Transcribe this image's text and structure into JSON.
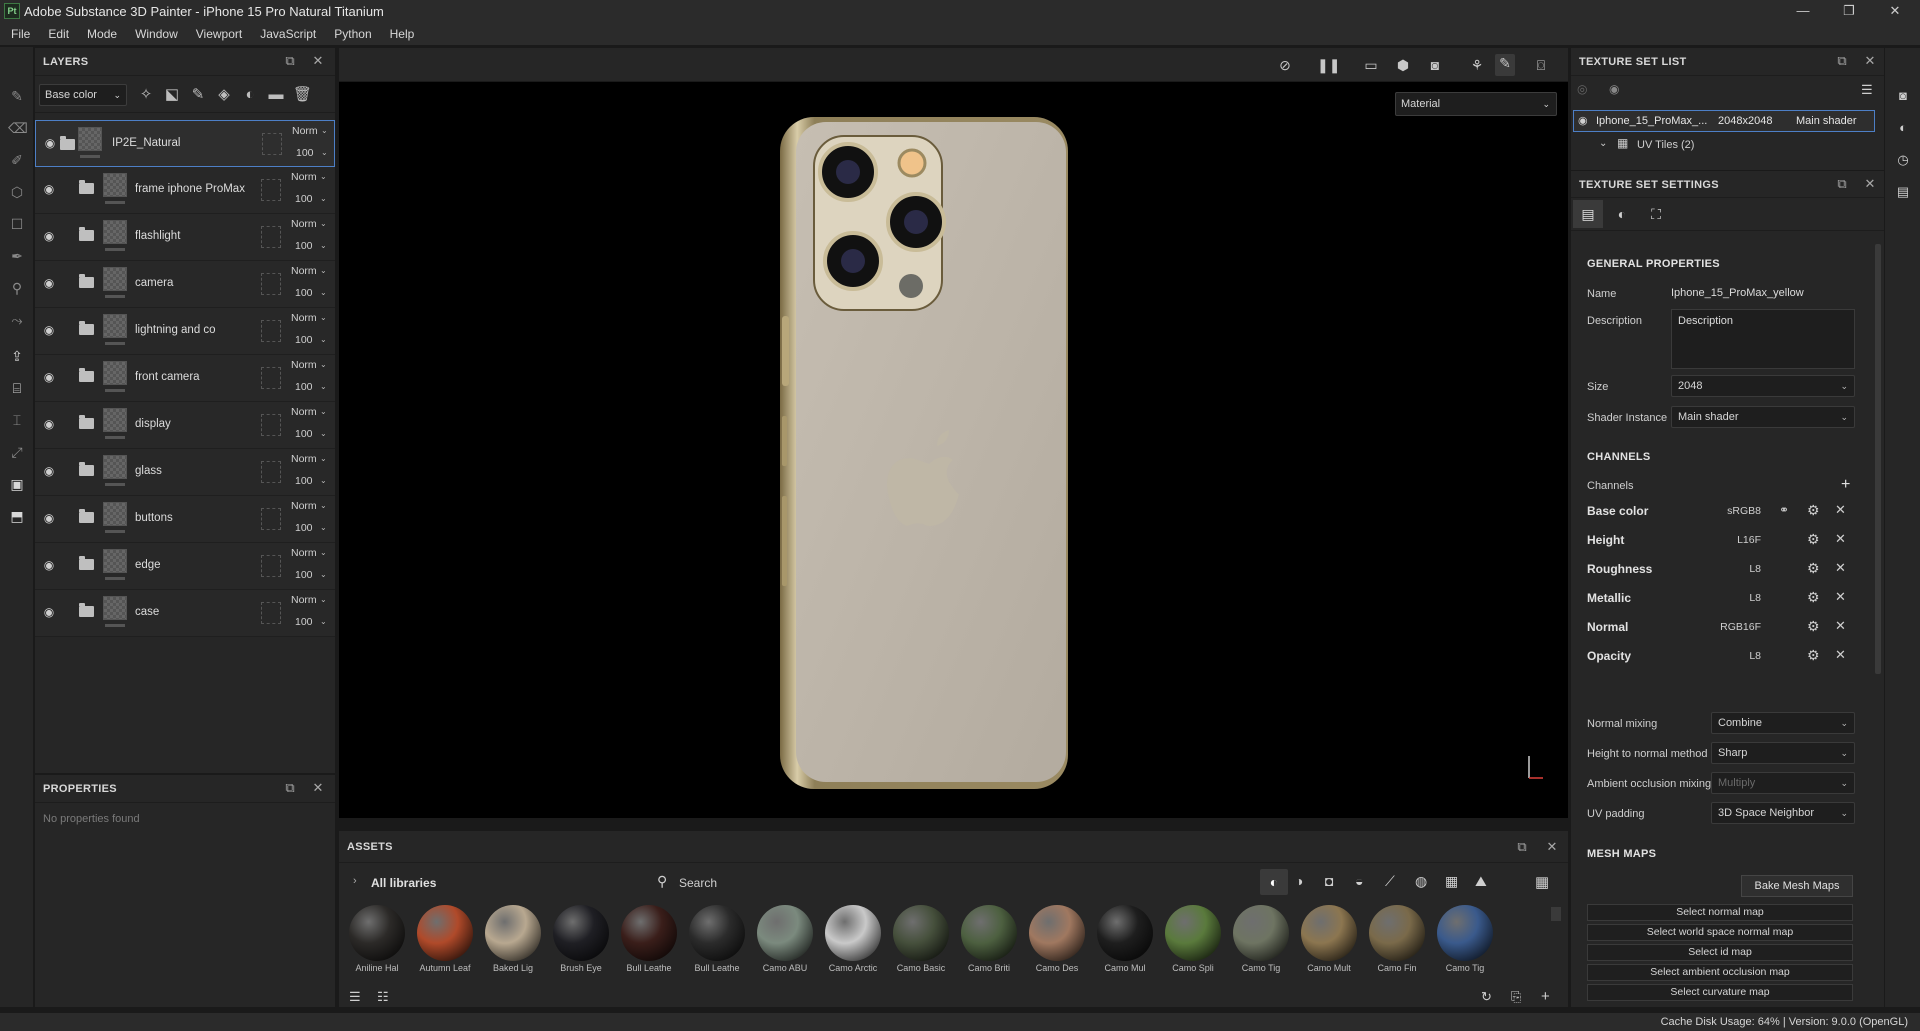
{
  "window": {
    "title": "Adobe Substance 3D Painter - iPhone 15 Pro Natural Titanium",
    "logo_text": "Pt",
    "minimize_label": "—",
    "maximize_label": "❐",
    "close_label": "✕"
  },
  "menubar": [
    "File",
    "Edit",
    "Mode",
    "Window",
    "Viewport",
    "JavaScript",
    "Python",
    "Help"
  ],
  "layers_panel": {
    "title": "LAYERS",
    "channel_select": "Base color",
    "layers": [
      {
        "name": "IP2E_Natural",
        "blend": "Norm",
        "opacity": "100",
        "selected": true
      },
      {
        "name": "frame iphone ProMax",
        "blend": "Norm",
        "opacity": "100"
      },
      {
        "name": "flashlight",
        "blend": "Norm",
        "opacity": "100"
      },
      {
        "name": "camera",
        "blend": "Norm",
        "opacity": "100"
      },
      {
        "name": "lightning and co",
        "blend": "Norm",
        "opacity": "100"
      },
      {
        "name": "front camera",
        "blend": "Norm",
        "opacity": "100"
      },
      {
        "name": "display",
        "blend": "Norm",
        "opacity": "100"
      },
      {
        "name": "glass",
        "blend": "Norm",
        "opacity": "100"
      },
      {
        "name": "buttons",
        "blend": "Norm",
        "opacity": "100"
      },
      {
        "name": "edge",
        "blend": "Norm",
        "opacity": "100"
      },
      {
        "name": "case",
        "blend": "Norm",
        "opacity": "100"
      }
    ]
  },
  "properties_panel": {
    "title": "PROPERTIES",
    "empty_text": "No properties found"
  },
  "viewport": {
    "view_mode": "Material"
  },
  "assets_panel": {
    "title": "ASSETS",
    "library": "All libraries",
    "search_placeholder": "Search",
    "materials": [
      {
        "label": "Aniline Hal",
        "color": "#2c2a28"
      },
      {
        "label": "Autumn Leaf",
        "color": "#b04a2a"
      },
      {
        "label": "Baked Lig",
        "color": "#b8a890"
      },
      {
        "label": "Brush Eye",
        "color": "#1f1f24"
      },
      {
        "label": "Bull Leathe",
        "color": "#3a1e1a"
      },
      {
        "label": "Bull Leathe",
        "color": "#2b2b2b"
      },
      {
        "label": "Camo ABU",
        "color": "#7b8a7e"
      },
      {
        "label": "Camo Arctic",
        "color": "#c9c9c9"
      },
      {
        "label": "Camo Basic",
        "color": "#46503c"
      },
      {
        "label": "Camo Briti",
        "color": "#4d6040"
      },
      {
        "label": "Camo Des",
        "color": "#a07860"
      },
      {
        "label": "Camo Mul",
        "color": "#1e1e1e"
      },
      {
        "label": "Camo Spli",
        "color": "#5a7a3c"
      },
      {
        "label": "Camo Tig",
        "color": "#6e7462"
      },
      {
        "label": "Camo Mult",
        "color": "#8c7650"
      },
      {
        "label": "Camo Fin",
        "color": "#7a6a4a"
      },
      {
        "label": "Camo Tig",
        "color": "#3a5a8c"
      }
    ]
  },
  "texture_set_list": {
    "title": "TEXTURE SET LIST",
    "item_name": "Iphone_15_ProMax_...",
    "item_size": "2048x2048",
    "item_shader": "Main shader",
    "uv_tiles": "UV Tiles (2)"
  },
  "texture_set_settings": {
    "title": "TEXTURE SET SETTINGS",
    "general_heading": "GENERAL PROPERTIES",
    "name_label": "Name",
    "name_value": "Iphone_15_ProMax_yellow",
    "description_label": "Description",
    "description_value": "Description",
    "size_label": "Size",
    "size_value": "2048",
    "shader_label": "Shader Instance",
    "shader_value": "Main shader",
    "channels_heading": "CHANNELS",
    "channels_label": "Channels",
    "channels": [
      {
        "name": "Base color",
        "format": "sRGB8"
      },
      {
        "name": "Height",
        "format": "L16F"
      },
      {
        "name": "Roughness",
        "format": "L8"
      },
      {
        "name": "Metallic",
        "format": "L8"
      },
      {
        "name": "Normal",
        "format": "RGB16F"
      },
      {
        "name": "Opacity",
        "format": "L8"
      }
    ],
    "normal_mixing_label": "Normal mixing",
    "normal_mixing_value": "Combine",
    "height_normal_label": "Height to normal method",
    "height_normal_value": "Sharp",
    "ao_mixing_label": "Ambient occlusion mixing",
    "ao_mixing_value": "Multiply",
    "uv_padding_label": "UV padding",
    "uv_padding_value": "3D Space Neighbor",
    "mesh_heading": "MESH MAPS",
    "bake_button": "Bake Mesh Maps",
    "mesh_buttons": [
      "Select normal map",
      "Select world space normal map",
      "Select id map",
      "Select ambient occlusion map",
      "Select curvature map"
    ]
  },
  "statusbar": {
    "text": "Cache Disk Usage:   64% | Version: 9.0.0 (OpenGL)"
  }
}
